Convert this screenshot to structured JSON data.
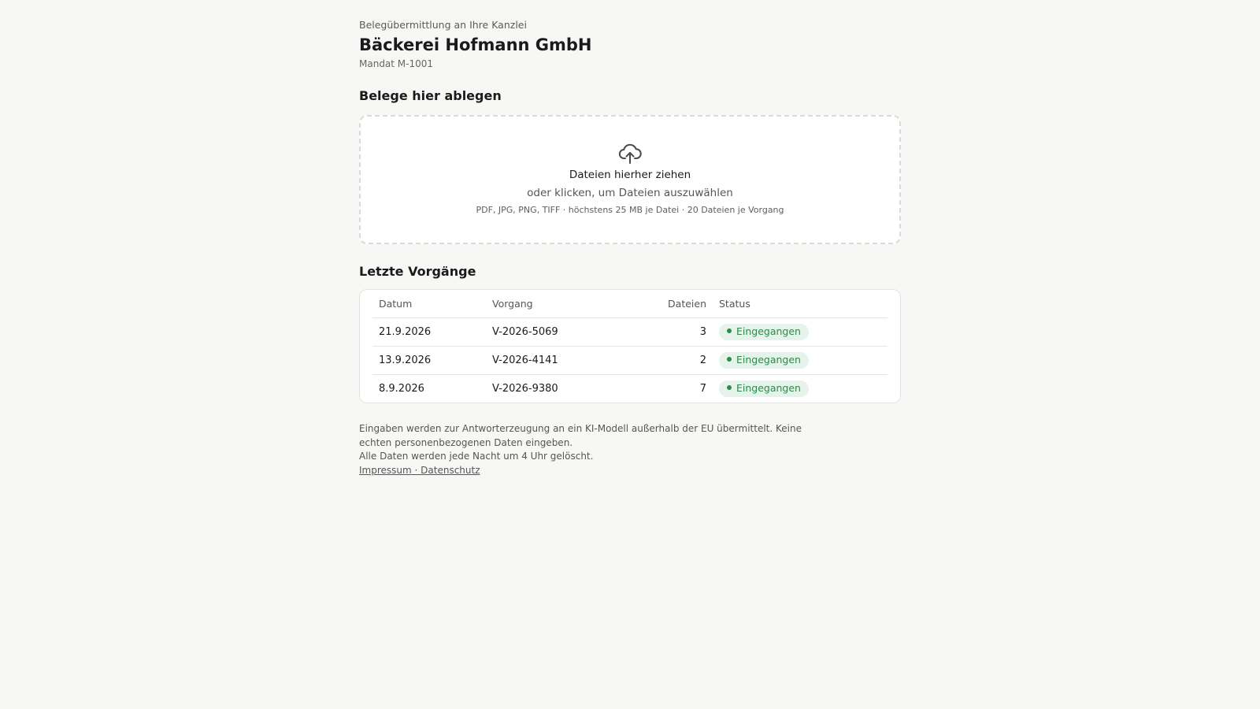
{
  "header": {
    "overline": "Belegübermittlung an Ihre Kanzlei",
    "title": "Bäckerei Hofmann GmbH",
    "mandate": "Mandat M-1001"
  },
  "upload": {
    "section_title": "Belege hier ablegen",
    "icon": "cloud-upload-icon",
    "primary": "Dateien hierher ziehen",
    "secondary": "oder klicken, um Dateien auszuwählen",
    "hint": "PDF, JPG, PNG, TIFF · höchstens 25 MB je Datei · 20 Dateien je Vorgang"
  },
  "recent": {
    "section_title": "Letzte Vorgänge",
    "columns": {
      "date": "Datum",
      "process": "Vorgang",
      "files": "Dateien",
      "status": "Status"
    },
    "rows": [
      {
        "date": "21.9.2026",
        "process": "V-2026-5069",
        "files": "3",
        "status": "Eingegangen"
      },
      {
        "date": "13.9.2026",
        "process": "V-2026-4141",
        "files": "2",
        "status": "Eingegangen"
      },
      {
        "date": "8.9.2026",
        "process": "V-2026-9380",
        "files": "7",
        "status": "Eingegangen"
      }
    ],
    "status_color": "#2c8a4b",
    "status_bg": "#e6f3ea"
  },
  "footer": {
    "notice_line1": "Eingaben werden zur Antworterzeugung an ein KI-Modell außerhalb der EU übermittelt. Keine echten personenbezogenen Daten eingeben.",
    "notice_line2": "Alle Daten werden jede Nacht um 4 Uhr gelöscht.",
    "link_impressum": "Impressum",
    "link_separator": " · ",
    "link_privacy": "Datenschutz"
  }
}
